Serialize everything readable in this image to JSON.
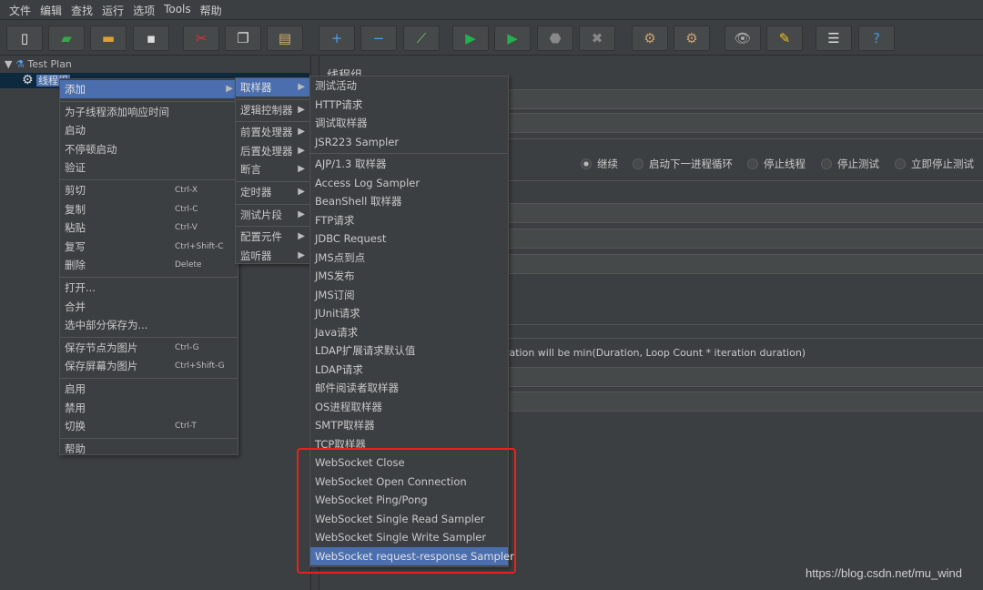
{
  "menubar": [
    "文件",
    "编辑",
    "查找",
    "运行",
    "选项",
    "Tools",
    "帮助"
  ],
  "toolbar": [
    {
      "icon": "new-icon",
      "g": "▯",
      "c": "#f2f2f2"
    },
    {
      "icon": "templates-icon",
      "g": "▰",
      "c": "#3aa64a"
    },
    {
      "icon": "open-icon",
      "g": "▬",
      "c": "#e0a030"
    },
    {
      "icon": "save-icon",
      "g": "▪",
      "c": "#dddddd"
    },
    {
      "icon": "cut-icon",
      "g": "✂",
      "c": "#e03030"
    },
    {
      "icon": "copy-icon",
      "g": "❐",
      "c": "#dddddd"
    },
    {
      "icon": "paste-icon",
      "g": "▤",
      "c": "#d9b070"
    },
    {
      "icon": "expand-icon",
      "g": "+",
      "c": "#4a9fe8"
    },
    {
      "icon": "collapse-icon",
      "g": "−",
      "c": "#4a9fe8"
    },
    {
      "icon": "toggle-icon",
      "g": "⟋",
      "c": "#7ac07a"
    },
    {
      "icon": "start-icon",
      "g": "▶",
      "c": "#22b14c"
    },
    {
      "icon": "start-no-pause-icon",
      "g": "▶",
      "c": "#22b14c"
    },
    {
      "icon": "stop-icon",
      "g": "⬣",
      "c": "#888888"
    },
    {
      "icon": "shutdown-icon",
      "g": "✖",
      "c": "#888888"
    },
    {
      "icon": "clear-icon",
      "g": "⚙",
      "c": "#c8a070"
    },
    {
      "icon": "clear-all-icon",
      "g": "⚙",
      "c": "#c8a070"
    },
    {
      "icon": "search-icon",
      "g": "👁",
      "c": "#aaaaaa"
    },
    {
      "icon": "reset-search-icon",
      "g": "✎",
      "c": "#f0c020"
    },
    {
      "icon": "function-helper-icon",
      "g": "☰",
      "c": "#dddddd"
    },
    {
      "icon": "help-icon",
      "g": "?",
      "c": "#4a90e2"
    }
  ],
  "tree": {
    "root": "Test Plan",
    "child": "线程组"
  },
  "right": {
    "title": "线程组",
    "radios": [
      {
        "label": "继续",
        "on": true
      },
      {
        "label": "启动下一进程循环"
      },
      {
        "label": "停止线程"
      },
      {
        "label": "停止测试"
      },
      {
        "label": "立即停止测试"
      }
    ],
    "duration_note": "uration will be min(Duration, Loop Count * iteration duration)"
  },
  "menu1": [
    {
      "label": "添加",
      "arrow": true,
      "hl": true
    },
    "-",
    {
      "label": "为子线程添加响应时间"
    },
    {
      "label": "启动"
    },
    {
      "label": "不停顿启动"
    },
    {
      "label": "验证"
    },
    "-",
    {
      "label": "剪切",
      "sc": "Ctrl-X"
    },
    {
      "label": "复制",
      "sc": "Ctrl-C"
    },
    {
      "label": "粘贴",
      "sc": "Ctrl-V"
    },
    {
      "label": "复写",
      "sc": "Ctrl+Shift-C"
    },
    {
      "label": "删除",
      "sc": "Delete"
    },
    "-",
    {
      "label": "打开..."
    },
    {
      "label": "合并"
    },
    {
      "label": "选中部分保存为..."
    },
    "-",
    {
      "label": "保存节点为图片",
      "sc": "Ctrl-G"
    },
    {
      "label": "保存屏幕为图片",
      "sc": "Ctrl+Shift-G"
    },
    "-",
    {
      "label": "启用"
    },
    {
      "label": "禁用"
    },
    {
      "label": "切换",
      "sc": "Ctrl-T"
    },
    "-",
    {
      "label": "帮助"
    }
  ],
  "menu2": [
    {
      "label": "取样器",
      "arrow": true,
      "hl": true
    },
    "-",
    {
      "label": "逻辑控制器",
      "arrow": true
    },
    "-",
    {
      "label": "前置处理器",
      "arrow": true
    },
    {
      "label": "后置处理器",
      "arrow": true
    },
    {
      "label": "断言",
      "arrow": true
    },
    "-",
    {
      "label": "定时器",
      "arrow": true
    },
    "-",
    {
      "label": "测试片段",
      "arrow": true
    },
    "-",
    {
      "label": "配置元件",
      "arrow": true
    },
    {
      "label": "监听器",
      "arrow": true
    }
  ],
  "menu3": [
    {
      "label": "测试活动"
    },
    {
      "label": "HTTP请求"
    },
    {
      "label": "调试取样器"
    },
    {
      "label": "JSR223 Sampler"
    },
    "-",
    {
      "label": "AJP/1.3 取样器"
    },
    {
      "label": "Access Log Sampler"
    },
    {
      "label": "BeanShell 取样器"
    },
    {
      "label": "FTP请求"
    },
    {
      "label": "JDBC Request"
    },
    {
      "label": "JMS点到点"
    },
    {
      "label": "JMS发布"
    },
    {
      "label": "JMS订阅"
    },
    {
      "label": "JUnit请求"
    },
    {
      "label": "Java请求"
    },
    {
      "label": "LDAP扩展请求默认值"
    },
    {
      "label": "LDAP请求"
    },
    {
      "label": "邮件阅读者取样器"
    },
    {
      "label": "OS进程取样器"
    },
    {
      "label": "SMTP取样器"
    },
    {
      "label": "TCP取样器"
    },
    {
      "label": "WebSocket Close"
    },
    {
      "label": "WebSocket Open Connection"
    },
    {
      "label": "WebSocket Ping/Pong"
    },
    {
      "label": "WebSocket Single Read Sampler"
    },
    {
      "label": "WebSocket Single Write Sampler"
    },
    {
      "label": "WebSocket request-response Sampler",
      "hl": true
    }
  ],
  "highlight_color": "#e8221b",
  "watermark": "https://blog.csdn.net/mu_wind"
}
